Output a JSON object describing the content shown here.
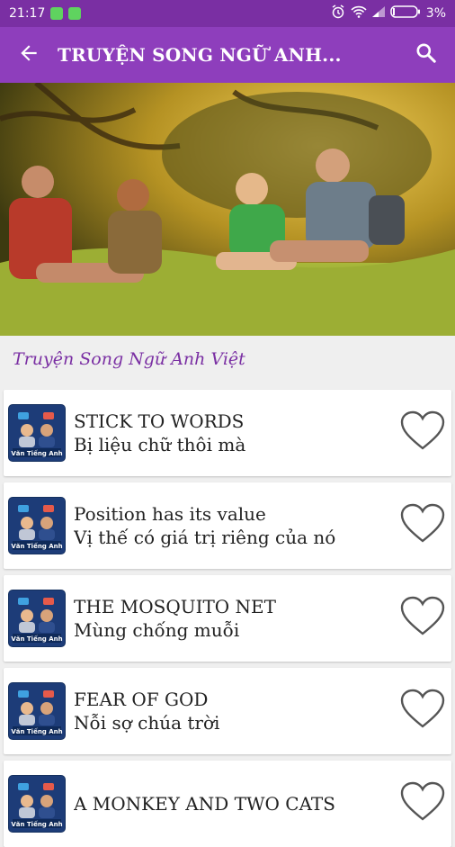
{
  "status": {
    "time": "21:17",
    "battery": "3%"
  },
  "appbar": {
    "title": "TRUYỆN SONG NGỮ ANH...",
    "back_icon": "arrow-left-icon",
    "search_icon": "search-icon"
  },
  "section": {
    "title": "Truyện Song Ngữ Anh Việt"
  },
  "stories": [
    {
      "en": "STICK TO WORDS",
      "vi": "Bị liệu chữ thôi mà"
    },
    {
      "en": "Position has its value",
      "vi": "Vị thế có giá trị riêng của nó"
    },
    {
      "en": "THE MOSQUITO NET",
      "vi": "Mùng chống muỗi"
    },
    {
      "en": "FEAR OF GOD",
      "vi": "Nỗi sợ chúa trời"
    },
    {
      "en": "A MONKEY AND TWO CATS",
      "vi": ""
    }
  ],
  "thumb_text": "Văn Tiếng Anh",
  "colors": {
    "statusbar": "#7a2fa3",
    "appbar": "#8e3ebc",
    "accent": "#7a2fa3"
  }
}
